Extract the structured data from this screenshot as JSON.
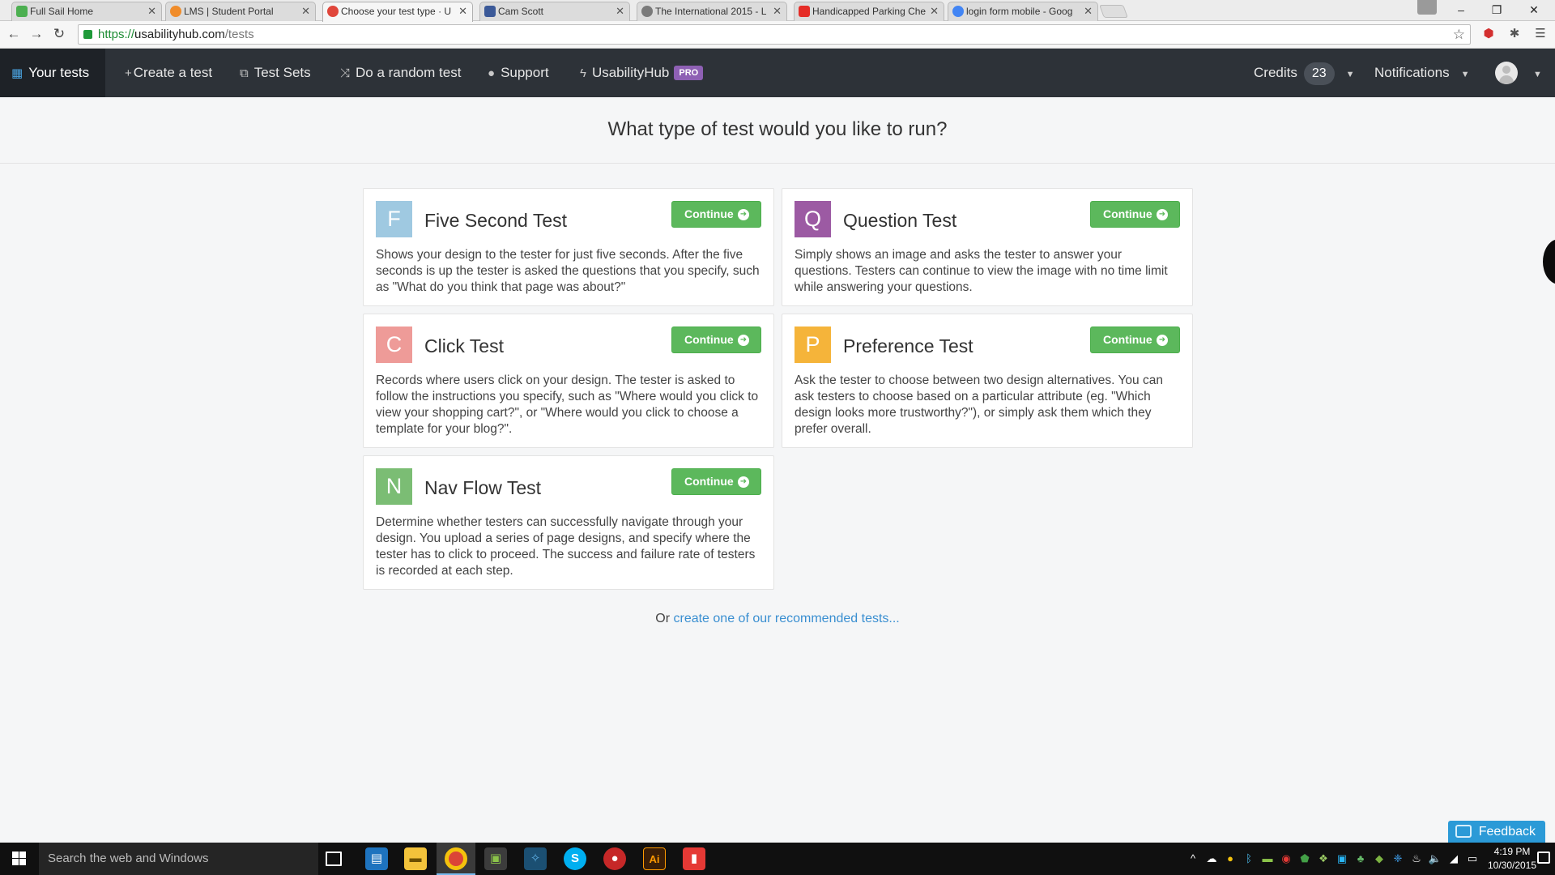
{
  "browser": {
    "tabs": [
      {
        "title": "Full Sail Home",
        "favicon_color": "#4caf50",
        "active": false
      },
      {
        "title": "LMS | Student Portal",
        "favicon_color": "#f08c2a",
        "active": false
      },
      {
        "title": "Choose your test type · U",
        "favicon_color": "#e0463b",
        "active": true
      },
      {
        "title": "Cam Scott",
        "favicon_color": "#3b5998",
        "active": false
      },
      {
        "title": "The International 2015 - L",
        "favicon_color": "#7a7a7a",
        "active": false
      },
      {
        "title": "Handicapped Parking Che",
        "favicon_color": "#e52d27",
        "active": false
      },
      {
        "title": "login form mobile - Goog",
        "favicon_color": "#4285f4",
        "active": false
      }
    ],
    "url_scheme": "https://",
    "url_host": "usabilityhub.com",
    "url_path": "/tests"
  },
  "nav": {
    "your_tests": "Your tests",
    "create_test": "Create a test",
    "test_sets": "Test Sets",
    "random_test": "Do a random test",
    "support": "Support",
    "usabilityhub": "UsabilityHub",
    "pro_badge": "PRO",
    "credits_label": "Credits",
    "credits_count": "23",
    "notifications": "Notifications"
  },
  "page": {
    "title": "What type of test would you like to run?",
    "continue_label": "Continue",
    "tests": {
      "five_second": {
        "letter": "F",
        "color": "#9fc9e1",
        "title": "Five Second Test",
        "description": "Shows your design to the tester for just five seconds. After the five seconds is up the tester is asked the questions that you specify, such as \"What do you think that page was about?\""
      },
      "question": {
        "letter": "Q",
        "color": "#9c5aa3",
        "title": "Question Test",
        "description": "Simply shows an image and asks the tester to answer your questions. Testers can continue to view the image with no time limit while answering your questions."
      },
      "click": {
        "letter": "C",
        "color": "#ee9b98",
        "title": "Click Test",
        "description": "Records where users click on your design. The tester is asked to follow the instructions you specify, such as \"Where would you click to view your shopping cart?\", or \"Where would you click to choose a template for your blog?\"."
      },
      "preference": {
        "letter": "P",
        "color": "#f5b43a",
        "title": "Preference Test",
        "description": "Ask the tester to choose between two design alternatives. You can ask testers to choose based on a particular attribute (eg. \"Which design looks more trustworthy?\"), or simply ask them which they prefer overall."
      },
      "nav_flow": {
        "letter": "N",
        "color": "#7bbd74",
        "title": "Nav Flow Test",
        "description": "Determine whether testers can successfully navigate through your design. You upload a series of page designs, and specify where the tester has to click to proceed. The success and failure rate of testers is recorded at each step."
      }
    },
    "recommend_prefix": "Or",
    "recommend_link": "create one of our recommended tests...",
    "feedback": "Feedback"
  },
  "taskbar": {
    "search_placeholder": "Search the web and Windows",
    "time": "4:19 PM",
    "date": "10/30/2015"
  }
}
